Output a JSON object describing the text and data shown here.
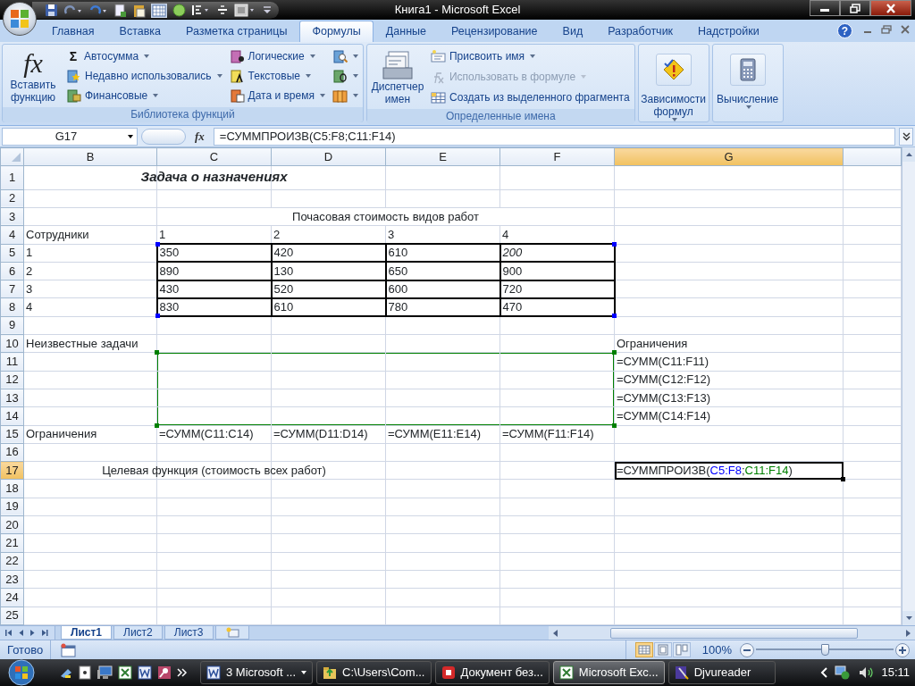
{
  "window": {
    "title": "Книга1 - Microsoft Excel"
  },
  "tabs": [
    {
      "label": "Главная",
      "selected": false
    },
    {
      "label": "Вставка",
      "selected": false
    },
    {
      "label": "Разметка страницы",
      "selected": false
    },
    {
      "label": "Формулы",
      "selected": true
    },
    {
      "label": "Данные",
      "selected": false
    },
    {
      "label": "Рецензирование",
      "selected": false
    },
    {
      "label": "Вид",
      "selected": false
    },
    {
      "label": "Разработчик",
      "selected": false
    },
    {
      "label": "Надстройки",
      "selected": false
    }
  ],
  "help_button": "?",
  "ribbon_groups": [
    {
      "label": "Библиотека функций",
      "large": [
        {
          "label": "Вставить функцию",
          "kind": "fx",
          "symbol": "fx",
          "dropdown": false
        }
      ],
      "columns": [
        [
          {
            "label": "Автосумма",
            "kind": "sum",
            "symbol": "Σ",
            "dropdown": true,
            "disabled": false
          },
          {
            "label": "Недавно использовались",
            "kind": "star-book",
            "dropdown": true,
            "disabled": false
          },
          {
            "label": "Финансовые",
            "kind": "money-book",
            "dropdown": true,
            "disabled": false
          }
        ],
        [
          {
            "label": "Логические",
            "kind": "question-book",
            "dropdown": true,
            "disabled": false
          },
          {
            "label": "Текстовые",
            "kind": "text-book",
            "dropdown": true,
            "disabled": false
          },
          {
            "label": "Дата и время",
            "kind": "calendar-book",
            "dropdown": true,
            "disabled": false
          }
        ],
        [
          {
            "kind": "search-book",
            "dropdown": true,
            "disabled": false
          },
          {
            "kind": "green-book",
            "dropdown": true,
            "disabled": false
          },
          {
            "kind": "books",
            "dropdown": true,
            "disabled": false
          }
        ]
      ]
    },
    {
      "label": "Определенные имена",
      "large": [
        {
          "label": "Диспетчер имен",
          "kind": "card-file",
          "dropdown": false
        }
      ],
      "columns": [
        [
          {
            "label": "Присвоить имя",
            "kind": "name-tag",
            "dropdown": true,
            "disabled": false
          },
          {
            "label": "Использовать в формуле",
            "kind": "fx-small",
            "dropdown": true,
            "disabled": true
          },
          {
            "label": "Создать из выделенного фрагмента",
            "kind": "table",
            "dropdown": false,
            "disabled": false
          }
        ]
      ]
    },
    {
      "large": [
        {
          "label": "Зависимости формул",
          "kind": "warning",
          "dropdown": true
        }
      ]
    },
    {
      "large": [
        {
          "label": "Вычисление",
          "kind": "calculator",
          "dropdown": true
        }
      ]
    }
  ],
  "formula_bar": {
    "name_box": "G17",
    "function_button": "fx",
    "formula": "=СУММПРОИЗВ(C5:F8;C11:F14)"
  },
  "columns": [
    {
      "label": "B",
      "selected": false
    },
    {
      "label": "C",
      "selected": false
    },
    {
      "label": "D",
      "selected": false
    },
    {
      "label": "E",
      "selected": false
    },
    {
      "label": "F",
      "selected": false
    },
    {
      "label": "G",
      "selected": true
    }
  ],
  "rows": [
    {
      "number": "1",
      "selected": false,
      "cells": {
        "C": {
          "text": "Задача о назначениях",
          "bold": true,
          "italic": true,
          "centered": true
        }
      }
    },
    {
      "number": "2",
      "selected": false
    },
    {
      "number": "3",
      "selected": false,
      "cells": {
        "C": {
          "text": "Почасовая стоимость видов работ",
          "centered": true,
          "merged": true
        }
      }
    },
    {
      "number": "4",
      "selected": false,
      "cells": {
        "B": "Сотрудники",
        "C": "1",
        "D": "2",
        "E": "3",
        "F": "4"
      }
    },
    {
      "number": "5",
      "selected": false,
      "cells": {
        "B": "1",
        "C": {
          "text": "350",
          "boxed": true
        },
        "D": {
          "text": "420",
          "boxed": true
        },
        "E": {
          "text": "610",
          "boxed": true
        },
        "F": {
          "text": "200",
          "boxed": true,
          "italic": true
        }
      }
    },
    {
      "number": "6",
      "selected": false,
      "cells": {
        "B": "2",
        "C": {
          "text": "890",
          "boxed": true
        },
        "D": {
          "text": "130",
          "boxed": true
        },
        "E": {
          "text": "650",
          "boxed": true
        },
        "F": {
          "text": "900",
          "boxed": true
        }
      }
    },
    {
      "number": "7",
      "selected": false,
      "cells": {
        "B": "3",
        "C": {
          "text": "430",
          "boxed": true
        },
        "D": {
          "text": "520",
          "boxed": true
        },
        "E": {
          "text": "600",
          "boxed": true
        },
        "F": {
          "text": "720",
          "boxed": true
        }
      }
    },
    {
      "number": "8",
      "selected": false,
      "cells": {
        "B": "4",
        "C": {
          "text": "830",
          "boxed": true
        },
        "D": {
          "text": "610",
          "boxed": true
        },
        "E": {
          "text": "780",
          "boxed": true
        },
        "F": {
          "text": "470",
          "boxed": true
        }
      }
    },
    {
      "number": "9",
      "selected": false
    },
    {
      "number": "10",
      "selected": false,
      "cells": {
        "B": "Неизвестные задачи",
        "G": "Ограничения"
      }
    },
    {
      "number": "11",
      "selected": false,
      "cells": {
        "G": "=СУММ(C11:F11)"
      }
    },
    {
      "number": "12",
      "selected": false,
      "cells": {
        "G": "=СУММ(C12:F12)"
      }
    },
    {
      "number": "13",
      "selected": false,
      "cells": {
        "G": "=СУММ(C13:F13)"
      }
    },
    {
      "number": "14",
      "selected": false,
      "cells": {
        "G": "=СУММ(C14:F14)"
      }
    },
    {
      "number": "15",
      "selected": false,
      "cells": {
        "B": "Ограничения",
        "C": "=СУММ(C11:C14)",
        "D": "=СУММ(D11:D14)",
        "E": "=СУММ(E11:E14)",
        "F": "=СУММ(F11:F14)"
      }
    },
    {
      "number": "16",
      "selected": false
    },
    {
      "number": "17",
      "selected": true,
      "cells": {
        "C": {
          "text": "Целевая функция (стоимость всех работ)",
          "centered": true
        },
        "G": {
          "active": true,
          "parts": [
            {
              "text": "=СУММПРОИЗВ("
            },
            {
              "text": "C5:F8",
              "kind": "ref",
              "color": "#0000ff"
            },
            {
              "text": ";"
            },
            {
              "text": "C11:F14",
              "kind": "ref",
              "color": "#008000"
            },
            {
              "text": ")"
            }
          ]
        }
      }
    },
    {
      "number": "18",
      "selected": false
    },
    {
      "number": "19",
      "selected": false
    },
    {
      "number": "20",
      "selected": false
    },
    {
      "number": "21",
      "selected": false
    },
    {
      "number": "22",
      "selected": false
    },
    {
      "number": "23",
      "selected": false
    },
    {
      "number": "24",
      "selected": false
    },
    {
      "number": "25",
      "selected": false
    }
  ],
  "sheet_tabs": [
    {
      "label": "Лист1",
      "selected": true
    },
    {
      "label": "Лист2",
      "selected": false
    },
    {
      "label": "Лист3",
      "selected": false
    }
  ],
  "status_bar": {
    "text": "Готово",
    "view_buttons": [
      {
        "selected": true
      },
      {
        "selected": false
      },
      {
        "selected": false
      }
    ],
    "zoom": "100%",
    "zoom_slider": {
      "level": 0.5
    }
  },
  "taskbar": {
    "buttons": [
      {
        "label": "3 Microsoft ...",
        "kind": "word",
        "selected": false,
        "dropdown": true
      },
      {
        "label": "C:\\Users\\Com...",
        "kind": "folder",
        "selected": false,
        "dropdown": false
      },
      {
        "label": "Документ без...",
        "kind": "red-app",
        "selected": false,
        "dropdown": false
      },
      {
        "label": "Microsoft Exc...",
        "kind": "excel",
        "selected": true,
        "dropdown": false
      },
      {
        "label": "Djvureader",
        "kind": "pen",
        "selected": false,
        "dropdown": false
      }
    ],
    "clock": "15:11"
  }
}
